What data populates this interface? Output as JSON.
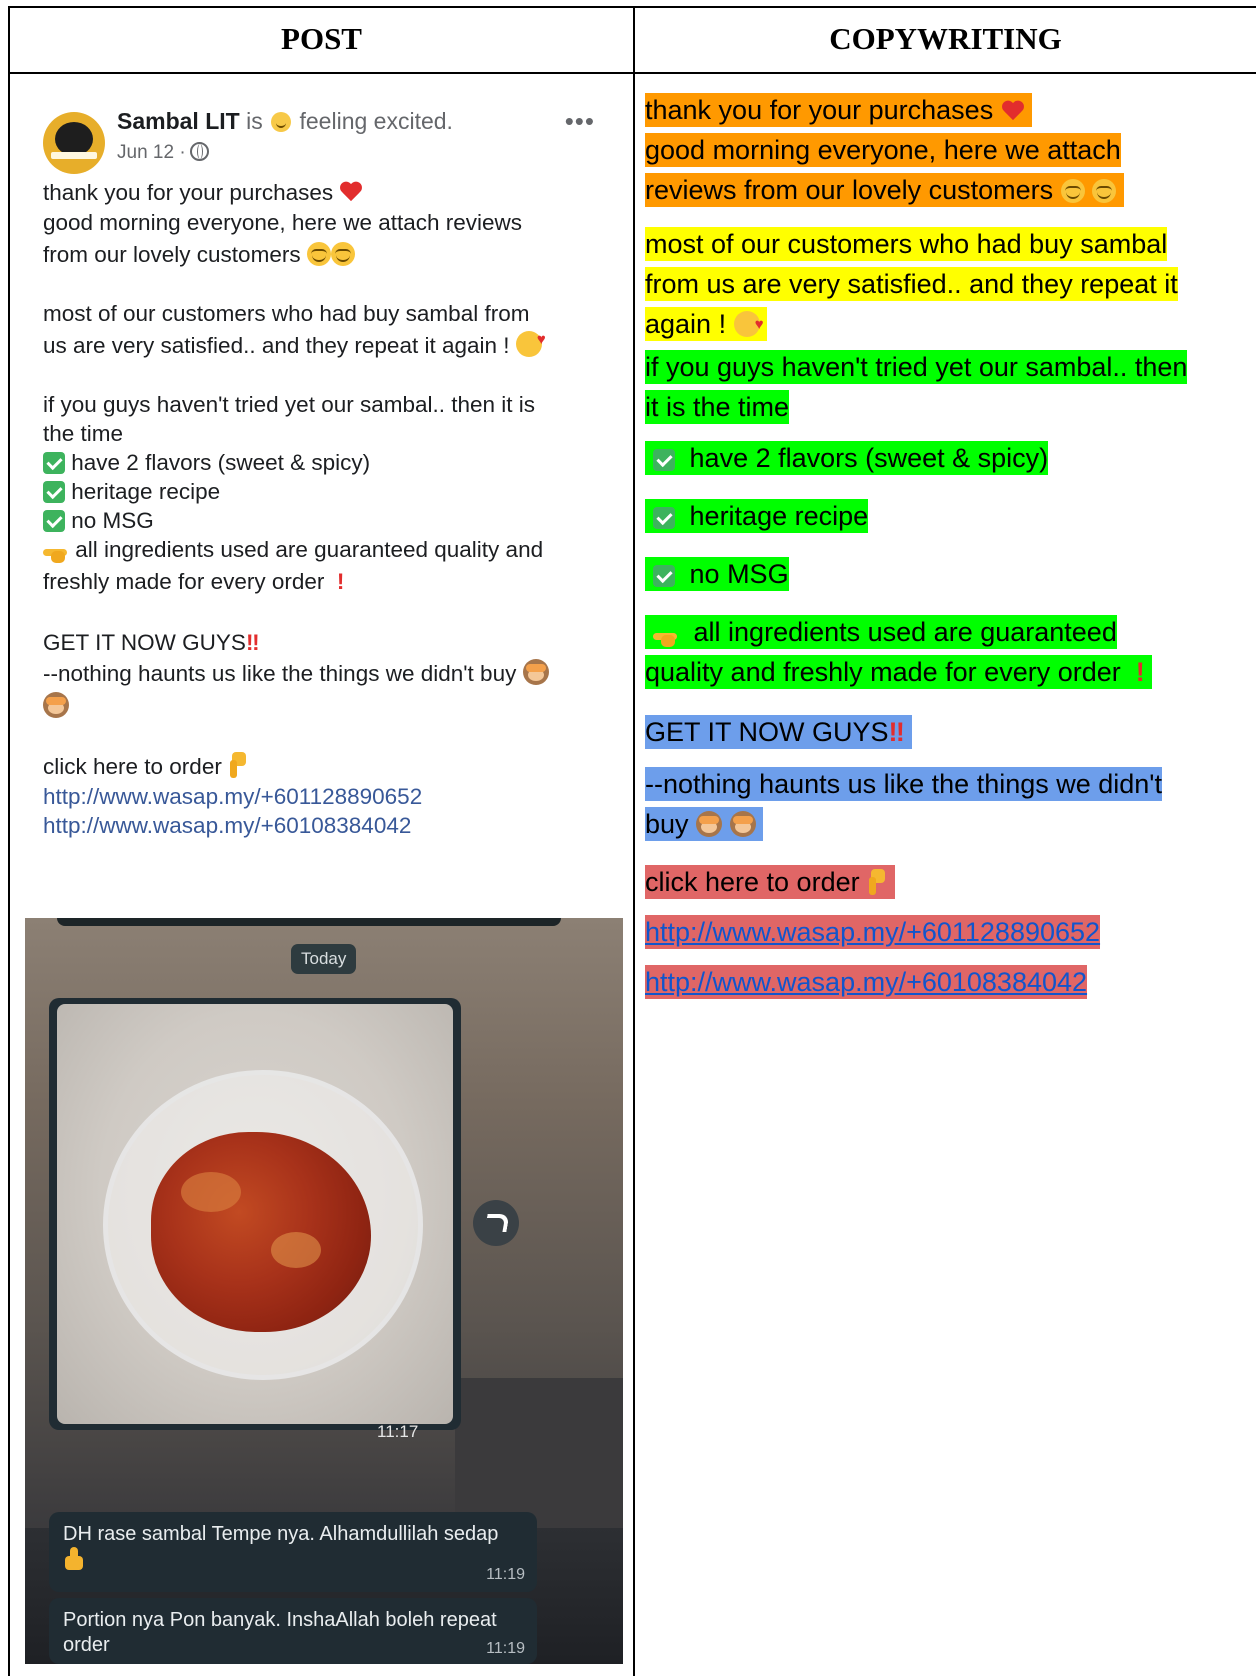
{
  "headers": {
    "post": "POST",
    "copywriting": "COPYWRITING"
  },
  "post": {
    "page_name": "Sambal LIT",
    "status_prefix": "is",
    "status_feeling": "feeling excited.",
    "date": "Jun 12 ·",
    "lines": {
      "l1": "thank you for your purchases",
      "l2": "good morning everyone, here we attach reviews",
      "l3": "from our lovely customers",
      "l4": "most of our customers who had buy sambal from",
      "l5": "us are very satisfied.. and they repeat it again !",
      "l6": "if you guys haven't tried yet our sambal.. then it is",
      "l7": "the time",
      "l8": "have 2 flavors (sweet & spicy)",
      "l9": "heritage recipe",
      "l10": "no MSG",
      "l11": "all ingredients used are guaranteed quality and",
      "l12": "freshly made for every order",
      "l13": "GET IT NOW GUYS",
      "l14": "--nothing haunts us like the things we didn't buy",
      "l15": "click here to order",
      "link1": "http://www.wasap.my/+601128890652",
      "link2": "http://www.wasap.my/+60108384042"
    },
    "exclaim_red": "!",
    "double_exclaim": "‼"
  },
  "chat": {
    "day_label": "Today",
    "photo_time": "11:17",
    "messages": [
      {
        "text1": "DH rase sambal Tempe nya. Alhamdullilah sedap",
        "time": "11:19"
      },
      {
        "text1": "Portion nya Pon banyak. InshaAllah boleh repeat",
        "text2": "order",
        "time": "11:19"
      }
    ]
  },
  "copywriting": {
    "c1": "thank you for your purchases",
    "c2": "good morning everyone, here we attach",
    "c3": "reviews from our lovely customers",
    "c4": "most of our customers who had buy sambal",
    "c5": "from us are very satisfied.. and they repeat it",
    "c6": "again !",
    "c7": "if you guys haven't tried yet our sambal.. then",
    "c8": "it is the time",
    "c9": "have 2 flavors (sweet & spicy)",
    "c10": "heritage recipe",
    "c11": "no MSG",
    "c12": "all ingredients used are guaranteed",
    "c13": "quality and freshly made for every order",
    "c14": "GET IT NOW GUYS",
    "c15": "--nothing haunts us like the things we didn't",
    "c16": "buy",
    "c17": "click here to order",
    "link1": "http://www.wasap.my/+601128890652",
    "link2": "http://www.wasap.my/+60108384042"
  },
  "colors": {
    "orange": "#ff9900",
    "yellow": "#ffff00",
    "green": "#00ff00",
    "blue": "#6d9eeb",
    "red": "#e06666",
    "link": "#1155cc"
  }
}
